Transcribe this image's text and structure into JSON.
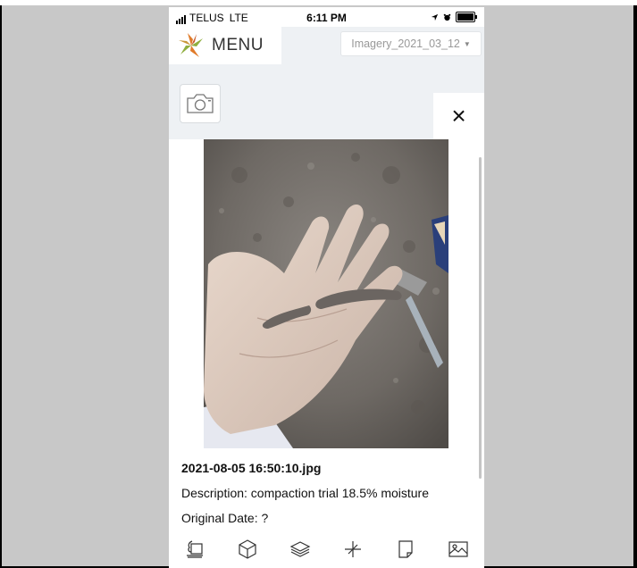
{
  "status_bar": {
    "carrier": "TELUS",
    "network": "LTE",
    "time": "6:11 PM"
  },
  "header": {
    "menu_label": "MENU",
    "imagery_select": "Imagery_2021_03_12"
  },
  "photo_viewer": {
    "close_label": "×",
    "file_name": "2021-08-05 16:50:10.jpg",
    "description": "Description: compaction trial 18.5% moisture",
    "original_date": "Original Date: ?"
  },
  "toolbar": {
    "items": [
      "soil-sample-icon",
      "cube-icon",
      "layers-icon",
      "crosshair-icon",
      "note-icon",
      "image-icon"
    ]
  },
  "colors": {
    "app_background": "#eef1f4",
    "logo_orange": "#e07b2a",
    "logo_green": "#8fae3f"
  }
}
